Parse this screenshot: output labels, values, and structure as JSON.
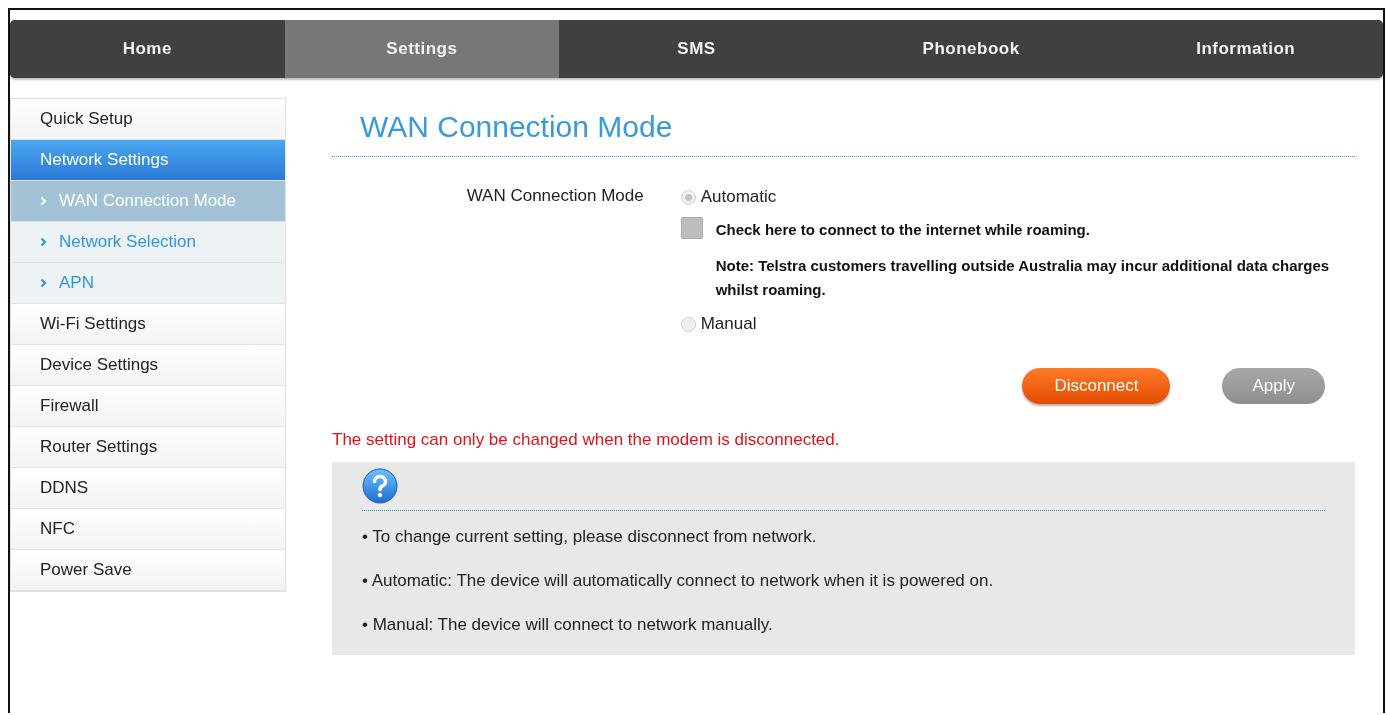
{
  "nav": [
    {
      "label": "Home",
      "selected": false
    },
    {
      "label": "Settings",
      "selected": true
    },
    {
      "label": "SMS",
      "selected": false
    },
    {
      "label": "Phonebook",
      "selected": false
    },
    {
      "label": "Information",
      "selected": false
    }
  ],
  "sidebar": {
    "items": [
      {
        "label": "Quick Setup",
        "selected": false
      },
      {
        "label": "Network Settings",
        "selected": true,
        "children": [
          {
            "label": "WAN Connection Mode",
            "selected": true
          },
          {
            "label": "Network Selection",
            "selected": false
          },
          {
            "label": "APN",
            "selected": false
          }
        ]
      },
      {
        "label": "Wi-Fi Settings",
        "selected": false
      },
      {
        "label": "Device Settings",
        "selected": false
      },
      {
        "label": "Firewall",
        "selected": false
      },
      {
        "label": "Router Settings",
        "selected": false
      },
      {
        "label": "DDNS",
        "selected": false
      },
      {
        "label": "NFC",
        "selected": false
      },
      {
        "label": "Power Save",
        "selected": false
      }
    ]
  },
  "page_title": "WAN Connection Mode",
  "form": {
    "label": "WAN Connection Mode",
    "options": [
      {
        "kind": "radio",
        "label": "Automatic",
        "selected": true,
        "disabled": true
      },
      {
        "kind": "checkbox",
        "label": "Check here to connect to the internet while roaming.",
        "checked": false,
        "disabled": true,
        "note": "Note: Telstra customers travelling outside Australia may incur additional data charges whilst roaming."
      },
      {
        "kind": "radio",
        "label": "Manual",
        "selected": false,
        "disabled": true
      }
    ]
  },
  "buttons": [
    {
      "label": "Disconnect",
      "disabled": false
    },
    {
      "label": "Apply",
      "disabled": true
    }
  ],
  "warning": "The setting can only be changed when the modem is disconnected.",
  "help": [
    "• To change current setting, please disconnect from network.",
    "• Automatic: The device will automatically connect to network when it is powered on.",
    "• Manual: The device will connect to network manually."
  ]
}
